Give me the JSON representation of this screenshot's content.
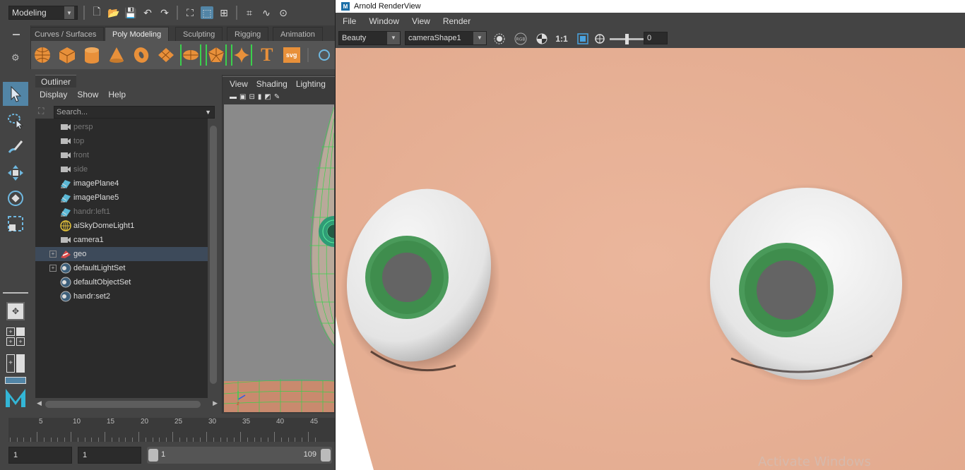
{
  "maya": {
    "mode": "Modeling",
    "shelf_tabs": [
      "Curves / Surfaces",
      "Poly Modeling",
      "Sculpting",
      "Rigging",
      "Animation"
    ],
    "shelf_active": "Poly Modeling",
    "outliner": {
      "title": "Outliner",
      "menu": [
        "Display",
        "Show",
        "Help"
      ],
      "search_placeholder": "Search...",
      "items": [
        {
          "label": "persp",
          "icon": "camera-icon",
          "dim": true
        },
        {
          "label": "top",
          "icon": "camera-icon",
          "dim": true
        },
        {
          "label": "front",
          "icon": "camera-icon",
          "dim": true
        },
        {
          "label": "side",
          "icon": "camera-icon",
          "dim": true
        },
        {
          "label": "imagePlane4",
          "icon": "image-plane-icon",
          "dim": false
        },
        {
          "label": "imagePlane5",
          "icon": "image-plane-icon",
          "dim": false
        },
        {
          "label": "handr:left1",
          "icon": "image-plane-icon",
          "dim": true
        },
        {
          "label": "aiSkyDomeLight1",
          "icon": "skydome-icon",
          "dim": false
        },
        {
          "label": "camera1",
          "icon": "camera-icon",
          "dim": false
        },
        {
          "label": "geo",
          "icon": "group-icon",
          "dim": false,
          "expandable": true,
          "selected": true
        },
        {
          "label": "defaultLightSet",
          "icon": "set-icon",
          "dim": false,
          "expandable": true
        },
        {
          "label": "defaultObjectSet",
          "icon": "set-icon",
          "dim": false
        },
        {
          "label": "handr:set2",
          "icon": "set-icon",
          "dim": false
        }
      ]
    },
    "viewport_menu": [
      "View",
      "Shading",
      "Lighting"
    ],
    "timeline_ticks": [
      "5",
      "10",
      "15",
      "20",
      "25",
      "30",
      "35",
      "40",
      "45"
    ],
    "range": {
      "start": "1",
      "playback_start": "1",
      "slider_start": "1",
      "slider_end": "109"
    }
  },
  "arnold": {
    "title": "Arnold RenderView",
    "menu": [
      "File",
      "Window",
      "View",
      "Render"
    ],
    "aov": "Beauty",
    "camera": "cameraShape1",
    "rgb_label": "RGB",
    "ratio_label": "1:1",
    "exposure": "0",
    "watermark": "Activate Windows"
  },
  "colors": {
    "skin": "#e5b096",
    "iris": "#4a9a5a",
    "pupil": "#646464",
    "accent": "#5285a6",
    "wireframe": "#3bd04d"
  }
}
